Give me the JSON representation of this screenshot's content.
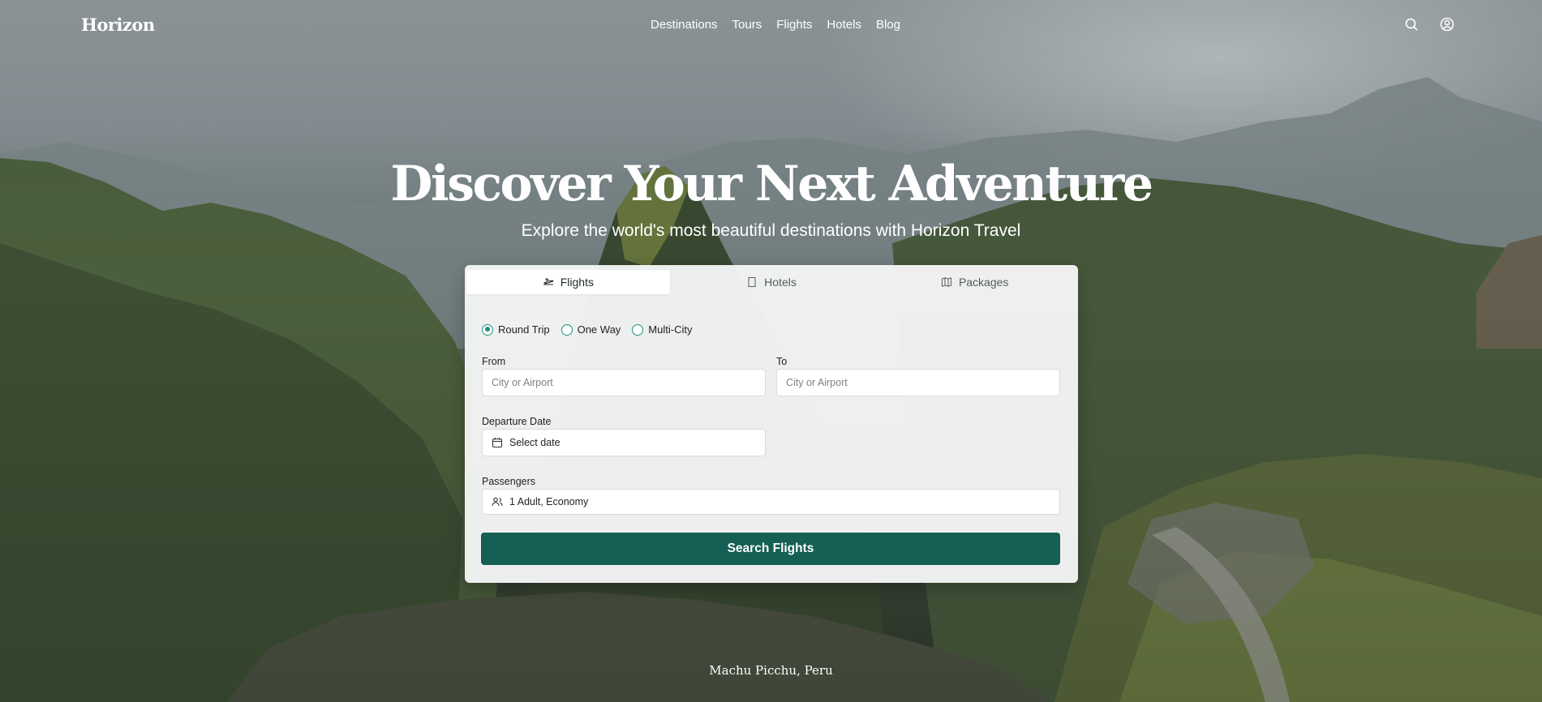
{
  "brand": {
    "name": "Horizon"
  },
  "nav": {
    "links": [
      "Destinations",
      "Tours",
      "Flights",
      "Hotels",
      "Blog"
    ],
    "icons": [
      "search-icon",
      "user-icon"
    ]
  },
  "hero": {
    "title": "Discover Your Next Adventure",
    "subtitle": "Explore the world's most beautiful destinations with Horizon Travel",
    "caption": "Machu Picchu, Peru"
  },
  "search": {
    "tabs": [
      {
        "label": "Flights",
        "icon": "plane-icon",
        "active": true
      },
      {
        "label": "Hotels",
        "icon": "building-icon",
        "active": false
      },
      {
        "label": "Packages",
        "icon": "map-icon",
        "active": false
      }
    ],
    "trip_types": [
      {
        "label": "Round Trip",
        "selected": true
      },
      {
        "label": "One Way",
        "selected": false
      },
      {
        "label": "Multi-City",
        "selected": false
      }
    ],
    "from": {
      "label": "From",
      "placeholder": "City or Airport"
    },
    "to": {
      "label": "To",
      "placeholder": "City or Airport"
    },
    "departure": {
      "label": "Departure Date",
      "value": "Select date"
    },
    "passengers": {
      "label": "Passengers",
      "value": "1 Adult, Economy"
    },
    "submit_label": "Search Flights"
  },
  "colors": {
    "accent": "#155f55",
    "radio": "#1f8f80",
    "card": "#f5f6f6"
  }
}
